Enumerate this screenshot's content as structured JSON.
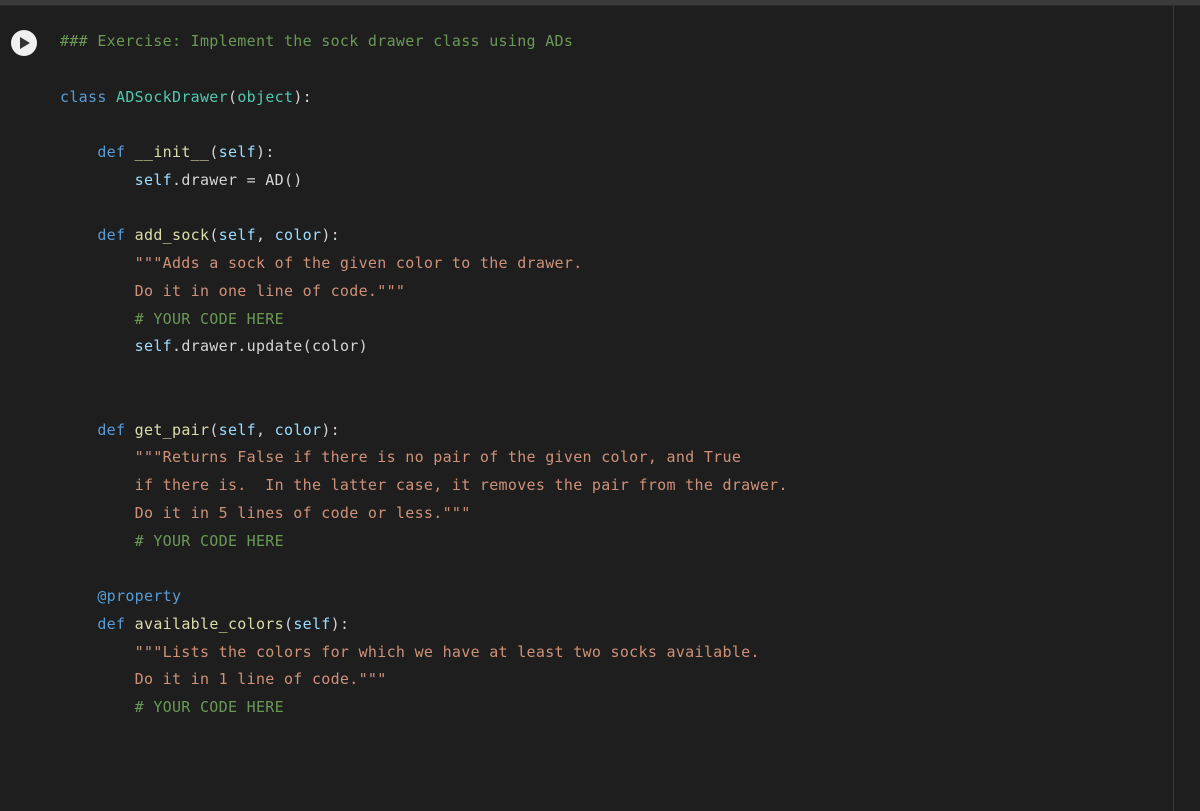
{
  "cell": {
    "header_comment": "### Exercise: Implement the sock drawer class using ADs",
    "class_kw": "class",
    "class_name": "ADSockDrawer",
    "object_name": "object",
    "def_kw": "def",
    "init_name": "__init__",
    "self_kw": "self",
    "init_body_self": "self",
    "init_body_attr": ".drawer = AD()",
    "add_sock_name": "add_sock",
    "color_param": "color",
    "add_sock_doc1": "\"\"\"Adds a sock of the given color to the drawer.",
    "add_sock_doc2": "Do it in one line of code.\"\"\"",
    "your_code1": "# YOUR CODE HERE",
    "add_sock_body_self": "self",
    "add_sock_body_rest": ".drawer.update(color)",
    "get_pair_name": "get_pair",
    "get_pair_doc1": "\"\"\"Returns False if there is no pair of the given color, and True",
    "get_pair_doc2": "if there is.  In the latter case, it removes the pair from the drawer.",
    "get_pair_doc3": "Do it in 5 lines of code or less.\"\"\"",
    "your_code2": "# YOUR CODE HERE",
    "decorator": "@property",
    "avail_name": "available_colors",
    "avail_doc1": "\"\"\"Lists the colors for which we have at least two socks available.",
    "avail_doc2": "Do it in 1 line of code.\"\"\"",
    "your_code3": "# YOUR CODE HERE"
  }
}
